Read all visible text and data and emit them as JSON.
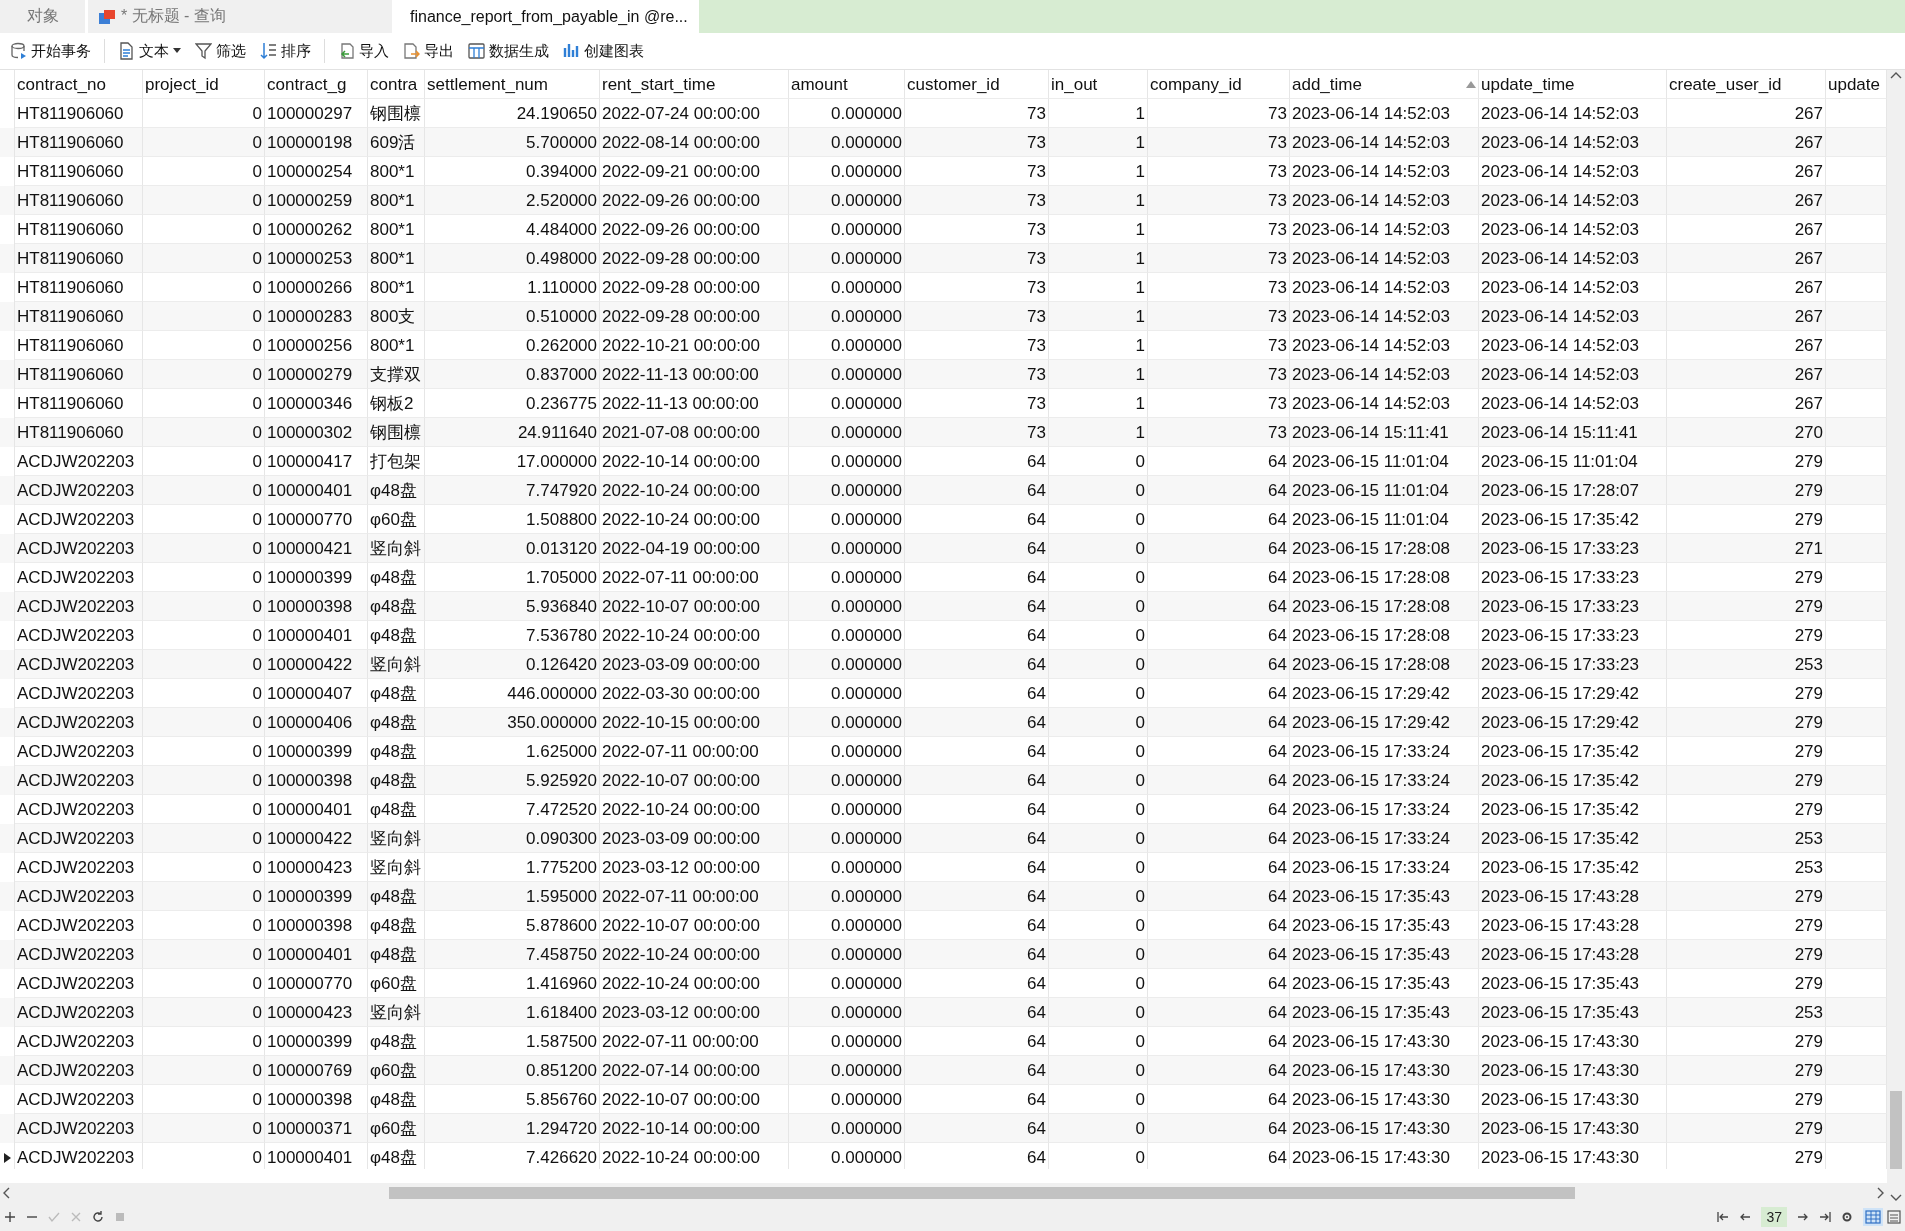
{
  "tabs": [
    {
      "label": "对象",
      "selected": false,
      "kind": "objects"
    },
    {
      "label": "* 无标题 - 查询",
      "selected": false,
      "kind": "query"
    },
    {
      "label": "finance_report_from_payable_in @re...",
      "selected": true,
      "kind": "table"
    }
  ],
  "toolbar": [
    {
      "label": "开始事务",
      "kind": "transaction"
    },
    {
      "label": "文本",
      "kind": "text"
    },
    {
      "label": "筛选",
      "kind": "filter"
    },
    {
      "label": "排序",
      "kind": "sort"
    },
    {
      "label": "导入",
      "kind": "import"
    },
    {
      "label": "导出",
      "kind": "export"
    },
    {
      "label": "数据生成",
      "kind": "generate"
    },
    {
      "label": "创建图表",
      "kind": "chart"
    }
  ],
  "table": {
    "columns": [
      {
        "label": "contract_no",
        "kind": "text",
        "sorted": false
      },
      {
        "label": "project_id",
        "kind": "number",
        "sorted": false
      },
      {
        "label": "contract_g",
        "kind": "text",
        "sorted": false
      },
      {
        "label": "contra",
        "kind": "text",
        "sorted": false
      },
      {
        "label": "settlement_num",
        "kind": "number",
        "sorted": false
      },
      {
        "label": "rent_start_time",
        "kind": "text",
        "sorted": false
      },
      {
        "label": "amount",
        "kind": "number",
        "sorted": false
      },
      {
        "label": "customer_id",
        "kind": "number",
        "sorted": false
      },
      {
        "label": "in_out",
        "kind": "number",
        "sorted": false
      },
      {
        "label": "company_id",
        "kind": "number",
        "sorted": false
      },
      {
        "label": "add_time",
        "kind": "text",
        "sorted": true
      },
      {
        "label": "update_time",
        "kind": "text",
        "sorted": false
      },
      {
        "label": "create_user_id",
        "kind": "number",
        "sorted": false
      },
      {
        "label": "update",
        "kind": "text",
        "sorted": false
      }
    ],
    "rows": [
      {
        "current": false,
        "cells": [
          "HT811906060",
          "0",
          "100000297",
          "钢围檩",
          "24.190650",
          "2022-07-24 00:00:00",
          "0.000000",
          "73",
          "1",
          "73",
          "2023-06-14 14:52:03",
          "2023-06-14 14:52:03",
          "267"
        ]
      },
      {
        "current": false,
        "cells": [
          "HT811906060",
          "0",
          "100000198",
          "609活",
          "5.700000",
          "2022-08-14 00:00:00",
          "0.000000",
          "73",
          "1",
          "73",
          "2023-06-14 14:52:03",
          "2023-06-14 14:52:03",
          "267"
        ]
      },
      {
        "current": false,
        "cells": [
          "HT811906060",
          "0",
          "100000254",
          "800*1",
          "0.394000",
          "2022-09-21 00:00:00",
          "0.000000",
          "73",
          "1",
          "73",
          "2023-06-14 14:52:03",
          "2023-06-14 14:52:03",
          "267"
        ]
      },
      {
        "current": false,
        "cells": [
          "HT811906060",
          "0",
          "100000259",
          "800*1",
          "2.520000",
          "2022-09-26 00:00:00",
          "0.000000",
          "73",
          "1",
          "73",
          "2023-06-14 14:52:03",
          "2023-06-14 14:52:03",
          "267"
        ]
      },
      {
        "current": false,
        "cells": [
          "HT811906060",
          "0",
          "100000262",
          "800*1",
          "4.484000",
          "2022-09-26 00:00:00",
          "0.000000",
          "73",
          "1",
          "73",
          "2023-06-14 14:52:03",
          "2023-06-14 14:52:03",
          "267"
        ]
      },
      {
        "current": false,
        "cells": [
          "HT811906060",
          "0",
          "100000253",
          "800*1",
          "0.498000",
          "2022-09-28 00:00:00",
          "0.000000",
          "73",
          "1",
          "73",
          "2023-06-14 14:52:03",
          "2023-06-14 14:52:03",
          "267"
        ]
      },
      {
        "current": false,
        "cells": [
          "HT811906060",
          "0",
          "100000266",
          "800*1",
          "1.110000",
          "2022-09-28 00:00:00",
          "0.000000",
          "73",
          "1",
          "73",
          "2023-06-14 14:52:03",
          "2023-06-14 14:52:03",
          "267"
        ]
      },
      {
        "current": false,
        "cells": [
          "HT811906060",
          "0",
          "100000283",
          "800支",
          "0.510000",
          "2022-09-28 00:00:00",
          "0.000000",
          "73",
          "1",
          "73",
          "2023-06-14 14:52:03",
          "2023-06-14 14:52:03",
          "267"
        ]
      },
      {
        "current": false,
        "cells": [
          "HT811906060",
          "0",
          "100000256",
          "800*1",
          "0.262000",
          "2022-10-21 00:00:00",
          "0.000000",
          "73",
          "1",
          "73",
          "2023-06-14 14:52:03",
          "2023-06-14 14:52:03",
          "267"
        ]
      },
      {
        "current": false,
        "cells": [
          "HT811906060",
          "0",
          "100000279",
          "支撑双",
          "0.837000",
          "2022-11-13 00:00:00",
          "0.000000",
          "73",
          "1",
          "73",
          "2023-06-14 14:52:03",
          "2023-06-14 14:52:03",
          "267"
        ]
      },
      {
        "current": false,
        "cells": [
          "HT811906060",
          "0",
          "100000346",
          "钢板2",
          "0.236775",
          "2022-11-13 00:00:00",
          "0.000000",
          "73",
          "1",
          "73",
          "2023-06-14 14:52:03",
          "2023-06-14 14:52:03",
          "267"
        ]
      },
      {
        "current": false,
        "cells": [
          "HT811906060",
          "0",
          "100000302",
          "钢围檩",
          "24.911640",
          "2021-07-08 00:00:00",
          "0.000000",
          "73",
          "1",
          "73",
          "2023-06-14 15:11:41",
          "2023-06-14 15:11:41",
          "270"
        ]
      },
      {
        "current": false,
        "cells": [
          "ACDJW202203",
          "0",
          "100000417",
          "打包架",
          "17.000000",
          "2022-10-14 00:00:00",
          "0.000000",
          "64",
          "0",
          "64",
          "2023-06-15 11:01:04",
          "2023-06-15 11:01:04",
          "279"
        ]
      },
      {
        "current": false,
        "cells": [
          "ACDJW202203",
          "0",
          "100000401",
          "φ48盘",
          "7.747920",
          "2022-10-24 00:00:00",
          "0.000000",
          "64",
          "0",
          "64",
          "2023-06-15 11:01:04",
          "2023-06-15 17:28:07",
          "279"
        ]
      },
      {
        "current": false,
        "cells": [
          "ACDJW202203",
          "0",
          "100000770",
          "φ60盘",
          "1.508800",
          "2022-10-24 00:00:00",
          "0.000000",
          "64",
          "0",
          "64",
          "2023-06-15 11:01:04",
          "2023-06-15 17:35:42",
          "279"
        ]
      },
      {
        "current": false,
        "cells": [
          "ACDJW202203",
          "0",
          "100000421",
          "竖向斜",
          "0.013120",
          "2022-04-19 00:00:00",
          "0.000000",
          "64",
          "0",
          "64",
          "2023-06-15 17:28:08",
          "2023-06-15 17:33:23",
          "271"
        ]
      },
      {
        "current": false,
        "cells": [
          "ACDJW202203",
          "0",
          "100000399",
          "φ48盘",
          "1.705000",
          "2022-07-11 00:00:00",
          "0.000000",
          "64",
          "0",
          "64",
          "2023-06-15 17:28:08",
          "2023-06-15 17:33:23",
          "279"
        ]
      },
      {
        "current": false,
        "cells": [
          "ACDJW202203",
          "0",
          "100000398",
          "φ48盘",
          "5.936840",
          "2022-10-07 00:00:00",
          "0.000000",
          "64",
          "0",
          "64",
          "2023-06-15 17:28:08",
          "2023-06-15 17:33:23",
          "279"
        ]
      },
      {
        "current": false,
        "cells": [
          "ACDJW202203",
          "0",
          "100000401",
          "φ48盘",
          "7.536780",
          "2022-10-24 00:00:00",
          "0.000000",
          "64",
          "0",
          "64",
          "2023-06-15 17:28:08",
          "2023-06-15 17:33:23",
          "279"
        ]
      },
      {
        "current": false,
        "cells": [
          "ACDJW202203",
          "0",
          "100000422",
          "竖向斜",
          "0.126420",
          "2023-03-09 00:00:00",
          "0.000000",
          "64",
          "0",
          "64",
          "2023-06-15 17:28:08",
          "2023-06-15 17:33:23",
          "253"
        ]
      },
      {
        "current": false,
        "cells": [
          "ACDJW202203",
          "0",
          "100000407",
          "φ48盘",
          "446.000000",
          "2022-03-30 00:00:00",
          "0.000000",
          "64",
          "0",
          "64",
          "2023-06-15 17:29:42",
          "2023-06-15 17:29:42",
          "279"
        ]
      },
      {
        "current": false,
        "cells": [
          "ACDJW202203",
          "0",
          "100000406",
          "φ48盘",
          "350.000000",
          "2022-10-15 00:00:00",
          "0.000000",
          "64",
          "0",
          "64",
          "2023-06-15 17:29:42",
          "2023-06-15 17:29:42",
          "279"
        ]
      },
      {
        "current": false,
        "cells": [
          "ACDJW202203",
          "0",
          "100000399",
          "φ48盘",
          "1.625000",
          "2022-07-11 00:00:00",
          "0.000000",
          "64",
          "0",
          "64",
          "2023-06-15 17:33:24",
          "2023-06-15 17:35:42",
          "279"
        ]
      },
      {
        "current": false,
        "cells": [
          "ACDJW202203",
          "0",
          "100000398",
          "φ48盘",
          "5.925920",
          "2022-10-07 00:00:00",
          "0.000000",
          "64",
          "0",
          "64",
          "2023-06-15 17:33:24",
          "2023-06-15 17:35:42",
          "279"
        ]
      },
      {
        "current": false,
        "cells": [
          "ACDJW202203",
          "0",
          "100000401",
          "φ48盘",
          "7.472520",
          "2022-10-24 00:00:00",
          "0.000000",
          "64",
          "0",
          "64",
          "2023-06-15 17:33:24",
          "2023-06-15 17:35:42",
          "279"
        ]
      },
      {
        "current": false,
        "cells": [
          "ACDJW202203",
          "0",
          "100000422",
          "竖向斜",
          "0.090300",
          "2023-03-09 00:00:00",
          "0.000000",
          "64",
          "0",
          "64",
          "2023-06-15 17:33:24",
          "2023-06-15 17:35:42",
          "253"
        ]
      },
      {
        "current": false,
        "cells": [
          "ACDJW202203",
          "0",
          "100000423",
          "竖向斜",
          "1.775200",
          "2023-03-12 00:00:00",
          "0.000000",
          "64",
          "0",
          "64",
          "2023-06-15 17:33:24",
          "2023-06-15 17:35:42",
          "253"
        ]
      },
      {
        "current": false,
        "cells": [
          "ACDJW202203",
          "0",
          "100000399",
          "φ48盘",
          "1.595000",
          "2022-07-11 00:00:00",
          "0.000000",
          "64",
          "0",
          "64",
          "2023-06-15 17:35:43",
          "2023-06-15 17:43:28",
          "279"
        ]
      },
      {
        "current": false,
        "cells": [
          "ACDJW202203",
          "0",
          "100000398",
          "φ48盘",
          "5.878600",
          "2022-10-07 00:00:00",
          "0.000000",
          "64",
          "0",
          "64",
          "2023-06-15 17:35:43",
          "2023-06-15 17:43:28",
          "279"
        ]
      },
      {
        "current": false,
        "cells": [
          "ACDJW202203",
          "0",
          "100000401",
          "φ48盘",
          "7.458750",
          "2022-10-24 00:00:00",
          "0.000000",
          "64",
          "0",
          "64",
          "2023-06-15 17:35:43",
          "2023-06-15 17:43:28",
          "279"
        ]
      },
      {
        "current": false,
        "cells": [
          "ACDJW202203",
          "0",
          "100000770",
          "φ60盘",
          "1.416960",
          "2022-10-24 00:00:00",
          "0.000000",
          "64",
          "0",
          "64",
          "2023-06-15 17:35:43",
          "2023-06-15 17:35:43",
          "279"
        ]
      },
      {
        "current": false,
        "cells": [
          "ACDJW202203",
          "0",
          "100000423",
          "竖向斜",
          "1.618400",
          "2023-03-12 00:00:00",
          "0.000000",
          "64",
          "0",
          "64",
          "2023-06-15 17:35:43",
          "2023-06-15 17:35:43",
          "253"
        ]
      },
      {
        "current": false,
        "cells": [
          "ACDJW202203",
          "0",
          "100000399",
          "φ48盘",
          "1.587500",
          "2022-07-11 00:00:00",
          "0.000000",
          "64",
          "0",
          "64",
          "2023-06-15 17:43:30",
          "2023-06-15 17:43:30",
          "279"
        ]
      },
      {
        "current": false,
        "cells": [
          "ACDJW202203",
          "0",
          "100000769",
          "φ60盘",
          "0.851200",
          "2022-07-14 00:00:00",
          "0.000000",
          "64",
          "0",
          "64",
          "2023-06-15 17:43:30",
          "2023-06-15 17:43:30",
          "279"
        ]
      },
      {
        "current": false,
        "cells": [
          "ACDJW202203",
          "0",
          "100000398",
          "φ48盘",
          "5.856760",
          "2022-10-07 00:00:00",
          "0.000000",
          "64",
          "0",
          "64",
          "2023-06-15 17:43:30",
          "2023-06-15 17:43:30",
          "279"
        ]
      },
      {
        "current": false,
        "cells": [
          "ACDJW202203",
          "0",
          "100000371",
          "φ60盘",
          "1.294720",
          "2022-10-14 00:00:00",
          "0.000000",
          "64",
          "0",
          "64",
          "2023-06-15 17:43:30",
          "2023-06-15 17:43:30",
          "279"
        ]
      },
      {
        "current": true,
        "cells": [
          "ACDJW202203",
          "0",
          "100000401",
          "φ48盘",
          "7.426620",
          "2022-10-24 00:00:00",
          "0.000000",
          "64",
          "0",
          "64",
          "2023-06-15 17:43:30",
          "2023-06-15 17:43:30",
          "279"
        ]
      }
    ]
  },
  "status_bar": {
    "record": "37"
  }
}
